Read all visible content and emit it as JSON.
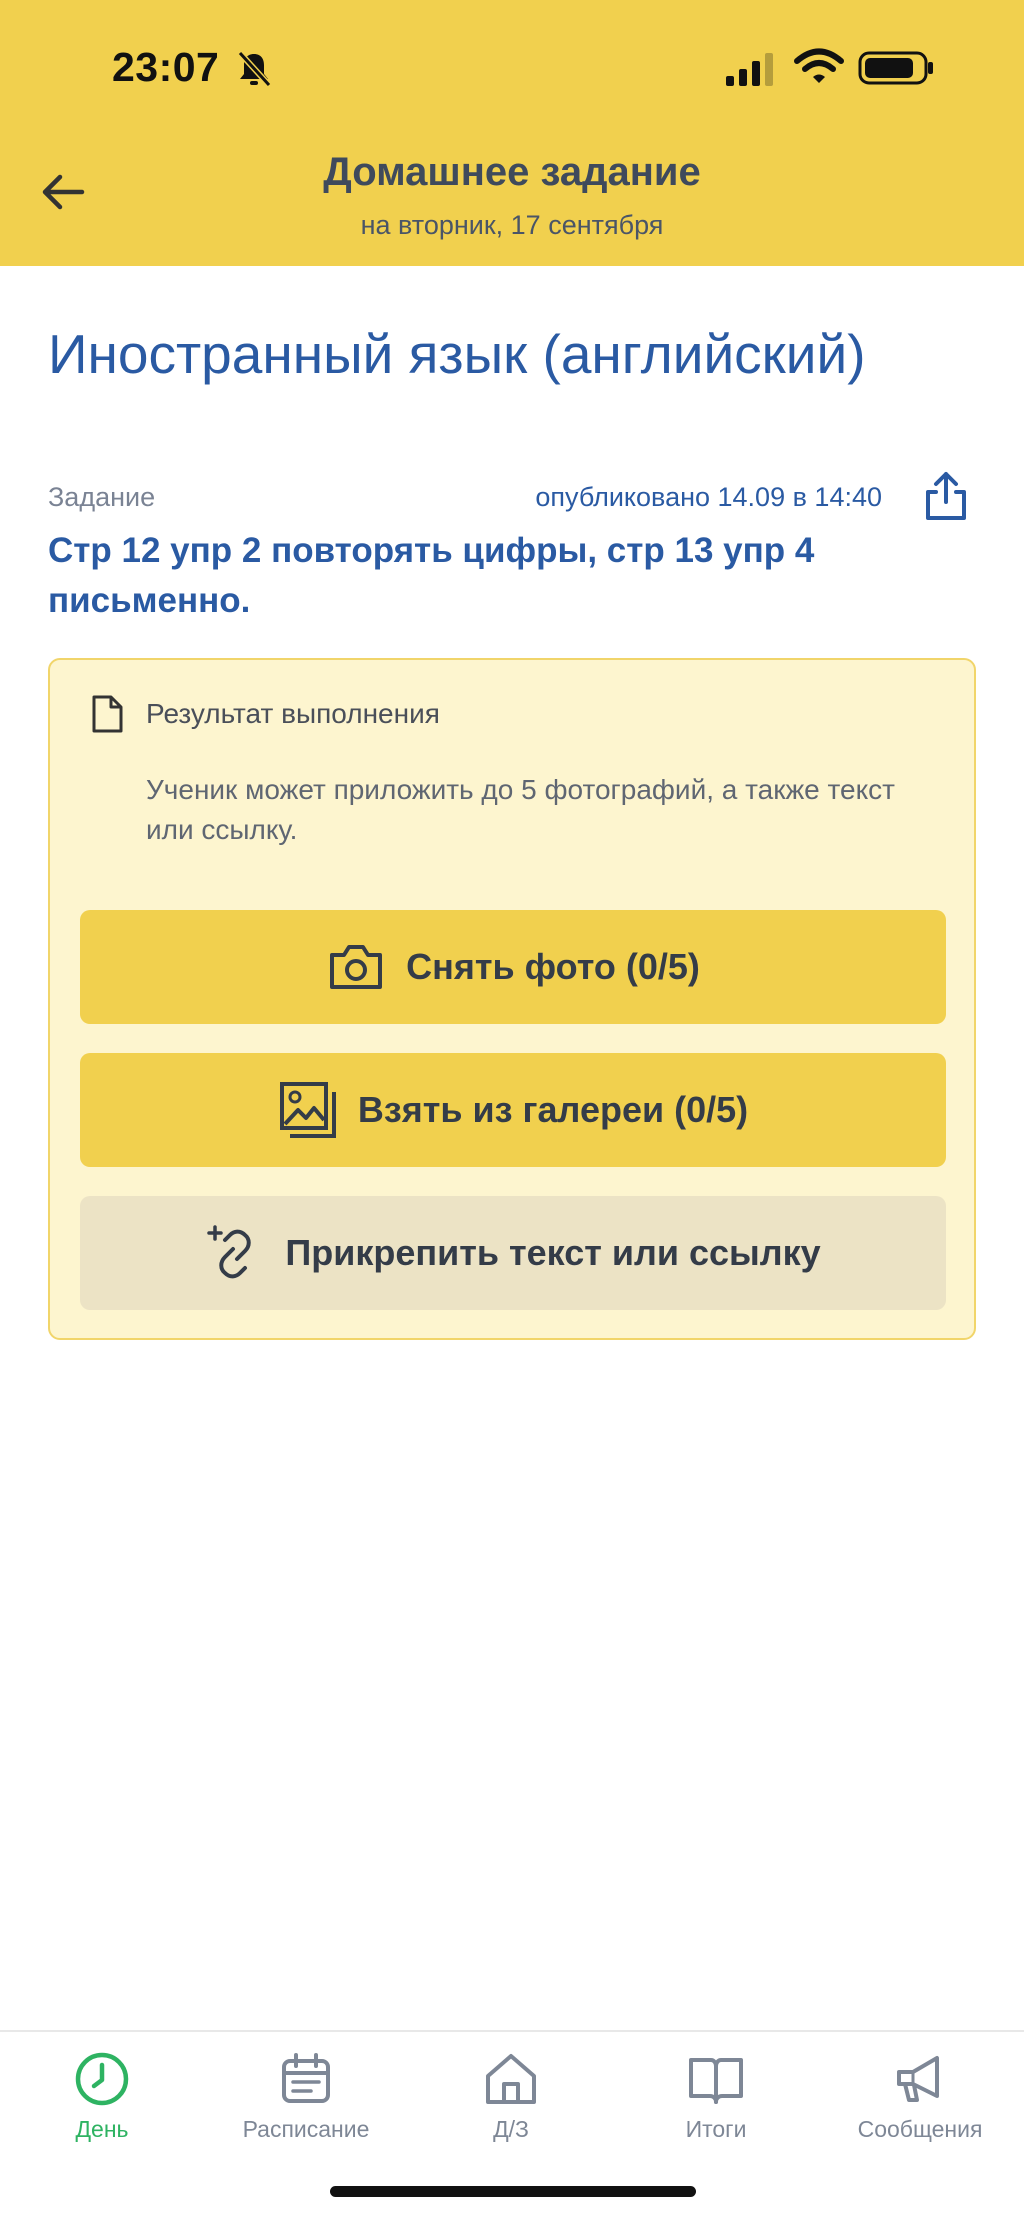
{
  "status_bar": {
    "time": "23:07",
    "icons": [
      "bell-slash-icon",
      "signal-icon",
      "wifi-icon",
      "battery-icon"
    ]
  },
  "header": {
    "title": "Домашнее задание",
    "subtitle": "на вторник, 17 сентября",
    "back_icon": "arrow-left-icon",
    "background": "#f1d04e"
  },
  "main": {
    "subject": "Иностранный язык (английский)",
    "task_label": "Задание",
    "published": "опубликовано 14.09 в 14:40",
    "share_icon": "share-icon",
    "task_text": "Стр 12 упр 2 повторять цифры, стр 13 упр 4 письменно."
  },
  "result": {
    "title": "Результат выполнения",
    "description": "Ученик может приложить до 5 фотографий, а также текст или ссылку.",
    "buttons": {
      "photo": {
        "label": "Снять фото (0/5)",
        "icon": "camera-icon"
      },
      "gallery": {
        "label": "Взять из галереи (0/5)",
        "icon": "gallery-icon"
      },
      "link": {
        "label": "Прикрепить текст или ссылку",
        "icon": "link-add-icon"
      }
    }
  },
  "tabbar": {
    "items": [
      {
        "label": "День",
        "icon": "clock-icon",
        "active": true
      },
      {
        "label": "Расписание",
        "icon": "calendar-icon",
        "active": false
      },
      {
        "label": "Д/З",
        "icon": "home-icon",
        "active": false
      },
      {
        "label": "Итоги",
        "icon": "book-icon",
        "active": false
      },
      {
        "label": "Сообщения",
        "icon": "megaphone-icon",
        "active": false
      }
    ]
  },
  "colors": {
    "accent_yellow": "#f1d04e",
    "text_blue": "#2a5aa3",
    "active_green": "#2eb362",
    "inactive_gray": "#7e8796"
  }
}
